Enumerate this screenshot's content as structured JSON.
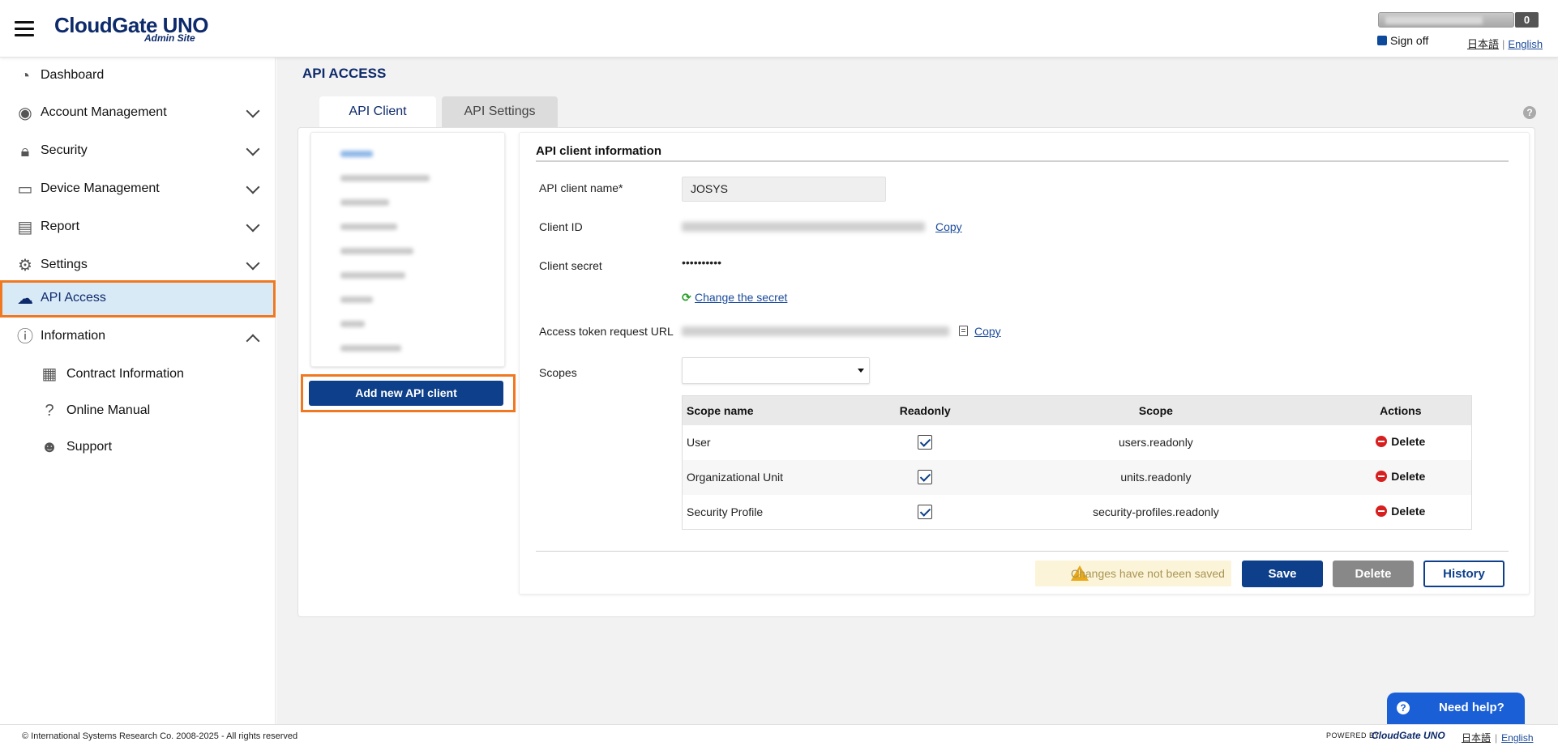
{
  "header": {
    "logo_title": "CloudGate UNO",
    "logo_subtitle": "Admin Site",
    "notification_count": "0",
    "sign_off_label": "Sign off",
    "lang_ja": "日本語",
    "lang_en": "English"
  },
  "sidebar": {
    "items": [
      {
        "label": "Dashboard",
        "icon": "dashboard-icon"
      },
      {
        "label": "Account Management",
        "icon": "user-icon"
      },
      {
        "label": "Security",
        "icon": "lock-icon"
      },
      {
        "label": "Device Management",
        "icon": "device-icon"
      },
      {
        "label": "Report",
        "icon": "report-icon"
      },
      {
        "label": "Settings",
        "icon": "settings-icon"
      },
      {
        "label": "API Access",
        "icon": "cloud-key-icon"
      },
      {
        "label": "Information",
        "icon": "info-icon"
      }
    ],
    "sub_items": [
      {
        "label": "Contract Information",
        "icon": "contract-icon"
      },
      {
        "label": "Online Manual",
        "icon": "question-icon"
      },
      {
        "label": "Support",
        "icon": "support-icon"
      }
    ]
  },
  "main": {
    "page_title": "API ACCESS",
    "tabs": [
      {
        "label": "API Client"
      },
      {
        "label": "API Settings"
      }
    ],
    "add_client_label": "Add new API client",
    "info": {
      "section_title": "API client information",
      "name_label": "API client name*",
      "name_value": "JOSYS",
      "client_id_label": "Client ID",
      "copy_label": "Copy",
      "secret_label": "Client secret",
      "secret_value": "••••••••••",
      "change_secret_label": "Change the secret",
      "token_url_label": "Access token request URL",
      "scopes_label": "Scopes"
    },
    "scope_table": {
      "headers": [
        "Scope name",
        "Readonly",
        "Scope",
        "Actions"
      ],
      "rows": [
        {
          "name": "User",
          "scope": "users.readonly",
          "action": "Delete"
        },
        {
          "name": "Organizational Unit",
          "scope": "units.readonly",
          "action": "Delete"
        },
        {
          "name": "Security Profile",
          "scope": "security-profiles.readonly",
          "action": "Delete"
        }
      ]
    },
    "unsaved_message": "Changes have not been saved",
    "buttons": {
      "save": "Save",
      "delete": "Delete",
      "history": "History"
    }
  },
  "need_help_label": "Need help?",
  "footer": {
    "copyright": "© International Systems Research Co.   2008-2025 - All rights reserved",
    "powered_by": "POWERED BY",
    "powered_logo": "CloudGate UNO",
    "lang_ja": "日本語",
    "lang_en": "English"
  },
  "colors": {
    "brand_navy": "#0d2a6b",
    "primary_button": "#0d3f8a",
    "highlight_orange": "#f07820",
    "active_nav_bg": "#d9eaf7",
    "delete_red": "#d81f1f"
  }
}
